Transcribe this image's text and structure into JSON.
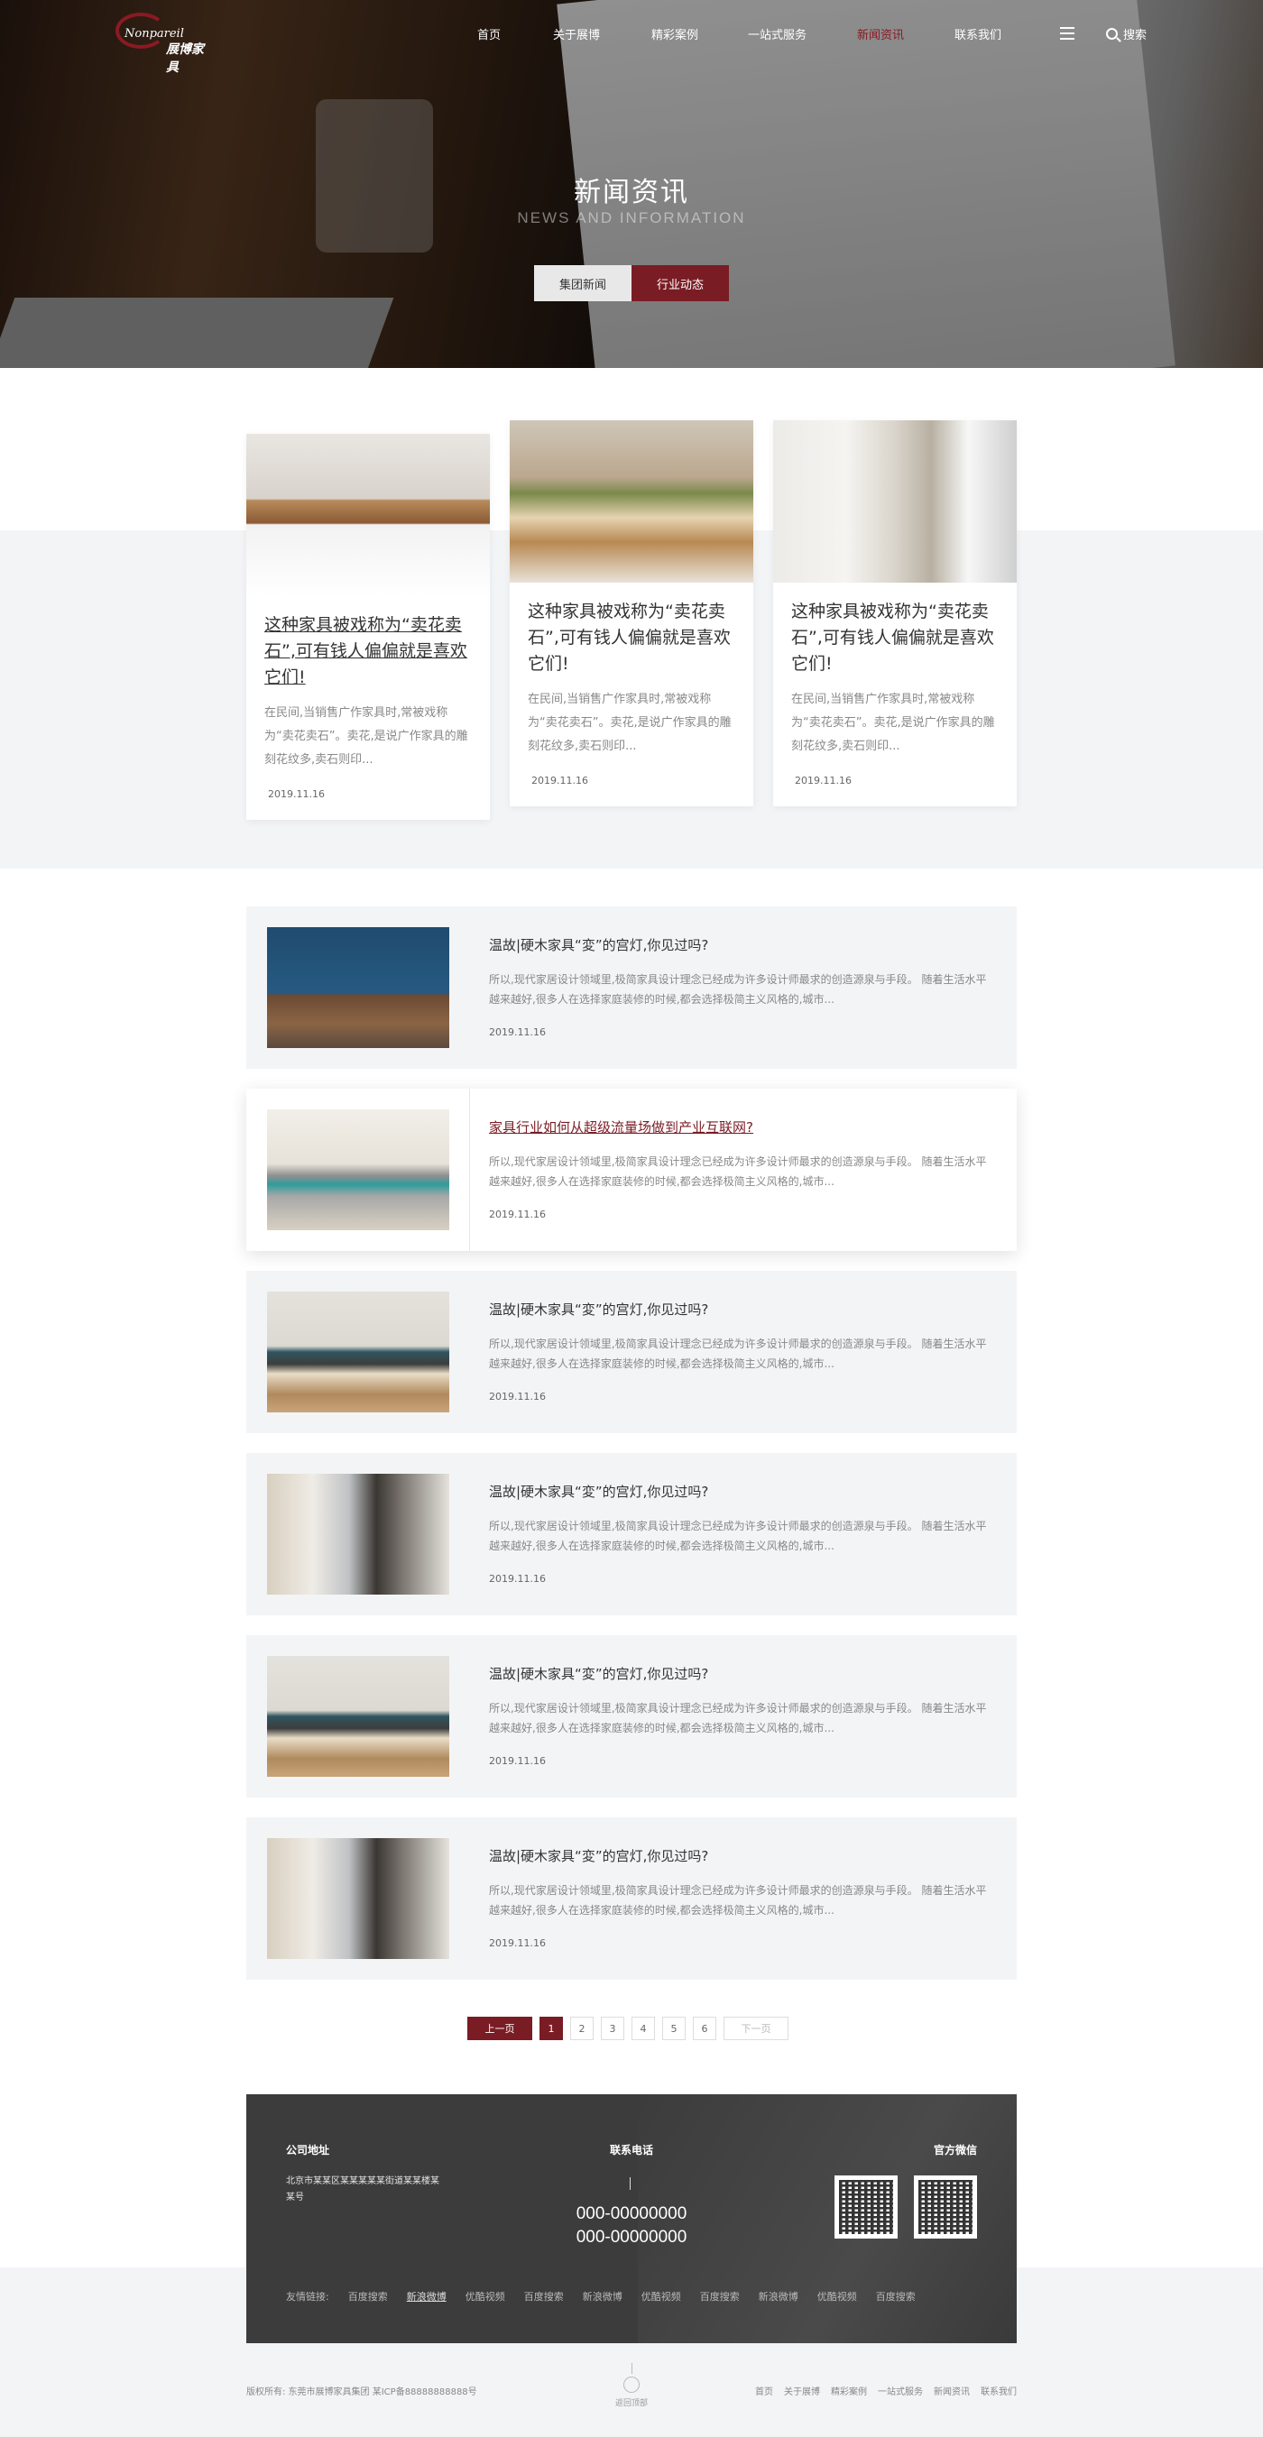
{
  "logo": {
    "en": "Nonpareil",
    "cn": "展博家具"
  },
  "nav": {
    "items": [
      "首页",
      "关于展博",
      "精彩案例",
      "一站式服务",
      "新闻资讯",
      "联系我们"
    ],
    "search_label": "搜索"
  },
  "hero": {
    "title": "新闻资讯",
    "subtitle": "NEWS AND INFORMATION",
    "tabs": [
      "集团新闻",
      "行业动态"
    ]
  },
  "featured_cards": [
    {
      "title": "这种家具被戏称为“卖花卖石”,可有钱人偏偏就是喜欢它们!",
      "desc": "在民间,当销售广作家具时,常被戏称为“卖花卖石”。卖花,是说广作家具的雕刻花纹多,卖石则印...",
      "date": "2019.11.16"
    },
    {
      "title": "这种家具被戏称为“卖花卖石”,可有钱人偏偏就是喜欢它们!",
      "desc": "在民间,当销售广作家具时,常被戏称为“卖花卖石”。卖花,是说广作家具的雕刻花纹多,卖石则印...",
      "date": "2019.11.16"
    },
    {
      "title": "这种家具被戏称为“卖花卖石”,可有钱人偏偏就是喜欢它们!",
      "desc": "在民间,当销售广作家具时,常被戏称为“卖花卖石”。卖花,是说广作家具的雕刻花纹多,卖石则印...",
      "date": "2019.11.16"
    }
  ],
  "news_list": [
    {
      "title": "温故|硬木家具“変”的宫灯,你见过吗?",
      "desc": "所以,现代家居设计领域里,极简家具设计理念已经成为许多设计师最求的创造源泉与手段。 随着生活水平越来越好,很多人在选择家庭装修的时候,都会选择极简主义风格的,城市...",
      "date": "2019.11.16"
    },
    {
      "title": "家具行业如何从超级流量场做到产业互联网?",
      "desc": "所以,现代家居设计领域里,极简家具设计理念已经成为许多设计师最求的创造源泉与手段。 随着生活水平越来越好,很多人在选择家庭装修的时候,都会选择极简主义风格的,城市...",
      "date": "2019.11.16"
    },
    {
      "title": "温故|硬木家具“変”的宫灯,你见过吗?",
      "desc": "所以,现代家居设计领域里,极简家具设计理念已经成为许多设计师最求的创造源泉与手段。 随着生活水平越来越好,很多人在选择家庭装修的时候,都会选择极简主义风格的,城市...",
      "date": "2019.11.16"
    },
    {
      "title": "温故|硬木家具“変”的宫灯,你见过吗?",
      "desc": "所以,现代家居设计领域里,极简家具设计理念已经成为许多设计师最求的创造源泉与手段。 随着生活水平越来越好,很多人在选择家庭装修的时候,都会选择极简主义风格的,城市...",
      "date": "2019.11.16"
    },
    {
      "title": "温故|硬木家具“変”的宫灯,你见过吗?",
      "desc": "所以,现代家居设计领域里,极简家具设计理念已经成为许多设计师最求的创造源泉与手段。 随着生活水平越来越好,很多人在选择家庭装修的时候,都会选择极简主义风格的,城市...",
      "date": "2019.11.16"
    },
    {
      "title": "温故|硬木家具“変”的宫灯,你见过吗?",
      "desc": "所以,现代家居设计领域里,极简家具设计理念已经成为许多设计师最求的创造源泉与手段。 随着生活水平越来越好,很多人在选择家庭装修的时候,都会选择极简主义风格的,城市...",
      "date": "2019.11.16"
    }
  ],
  "pagination": {
    "prev": "上一页",
    "pages": [
      "1",
      "2",
      "3",
      "4",
      "5",
      "6"
    ],
    "next": "下一页",
    "current": "1"
  },
  "footer": {
    "address_title": "公司地址",
    "address": "北京市某某区某某某某某街道某某楼某某号",
    "phone_title": "联系电话",
    "phones": [
      "000-00000000",
      "000-00000000"
    ],
    "wechat_title": "官方微信",
    "friend_links_label": "友情链接:",
    "friend_links": [
      "百度搜索",
      "新浪微博",
      "优酷视频",
      "百度搜索",
      "新浪微博",
      "优酷视频",
      "百度搜索",
      "新浪微博",
      "优酷视频",
      "百度搜索"
    ]
  },
  "bottom": {
    "copyright": "版权所有: 东莞市展博家具集团  某ICP备88888888888号",
    "back_top": "返回顶部",
    "nav": [
      "首页",
      "关于展博",
      "精彩案例",
      "一站式服务",
      "新闻资讯",
      "联系我们"
    ]
  },
  "colors": {
    "accent": "#7a1c24",
    "band": "#f3f4f6",
    "footer": "#3c3c3c"
  }
}
